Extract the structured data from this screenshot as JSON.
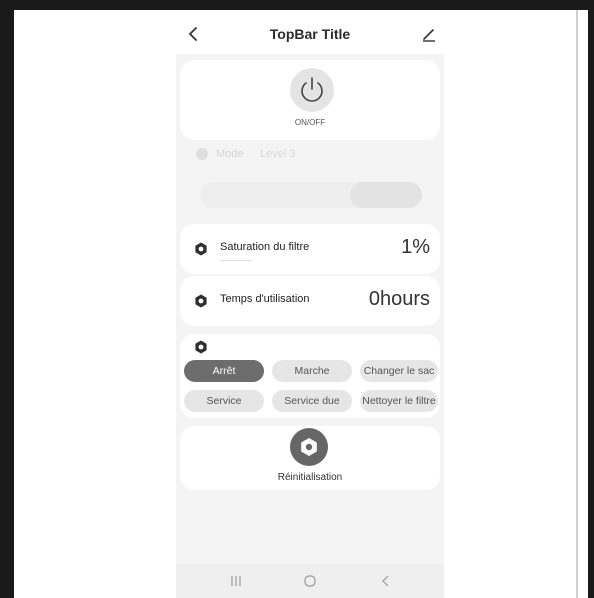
{
  "topbar": {
    "title": "TopBar Title",
    "back_icon": "chevron-left-icon",
    "edit_icon": "edit-pencil-icon"
  },
  "power": {
    "icon": "power-icon",
    "label": "ON/OFF"
  },
  "mode": {
    "label": "Mode",
    "value": "Level 3",
    "options": [
      "",
      "Level 3"
    ]
  },
  "filter_saturation": {
    "icon": "filter-hex-icon",
    "label": "Saturation du filtre",
    "value": "1%"
  },
  "usage_time": {
    "icon": "filter-hex-icon",
    "label": "Temps d'utilisation",
    "value": "0hours"
  },
  "status": {
    "icon": "filter-hex-icon",
    "options": [
      {
        "label": "Arrêt",
        "active": true
      },
      {
        "label": "Marche",
        "active": false
      },
      {
        "label": "Changer le sac",
        "active": false
      },
      {
        "label": "Service",
        "active": false
      },
      {
        "label": "Service due",
        "active": false
      },
      {
        "label": "Nettoyer le filtre",
        "active": false
      }
    ]
  },
  "reset": {
    "icon": "reset-hex-icon",
    "label": "Réinitialisation"
  },
  "navbar": {
    "items": [
      "recent-apps-icon",
      "home-icon",
      "back-icon"
    ]
  },
  "colors": {
    "background": "#f4f4f4",
    "card": "#ffffff",
    "active_pill": "#6d6d6d",
    "inactive_pill": "#e6e6e6"
  }
}
